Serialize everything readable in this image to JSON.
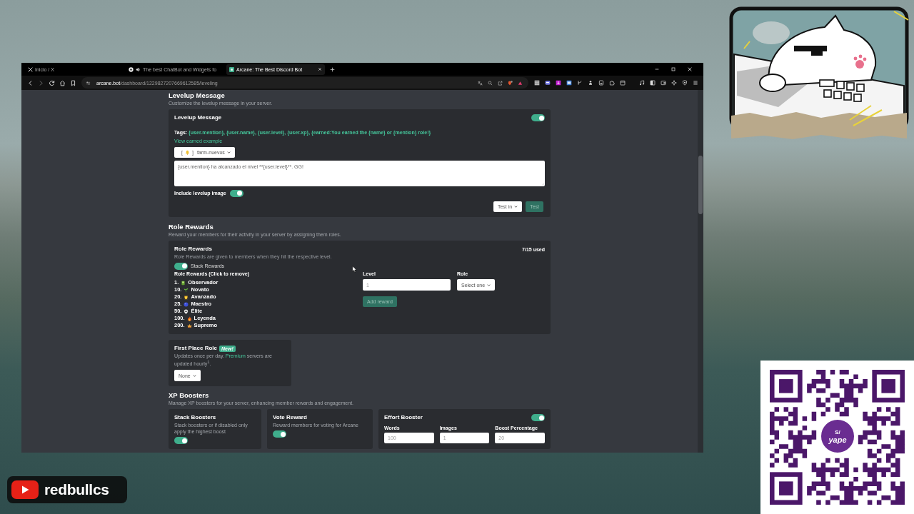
{
  "browser": {
    "tabs": [
      {
        "title": "Inicio / X",
        "kind": "x",
        "audio": false,
        "selected": false
      },
      {
        "title": "The best ChatBot and Widgets fo",
        "kind": "chatbot",
        "audio": true,
        "selected": false
      },
      {
        "title": "Arcane: The Best Discord Bot",
        "kind": "arcane",
        "audio": false,
        "selected": true
      }
    ],
    "url": {
      "domain": "arcane.bot",
      "path": "/dashboard/1229827207669612585/leveling"
    }
  },
  "levelup_message": {
    "heading": "Levelup Message",
    "subtitle": "Customize the levelup message in your server.",
    "card_title": "Levelup Message",
    "enabled": true,
    "tags_label": "Tags:",
    "tags": "{user.mention}, {user.name}, {user.level}, {user.xp}, {earned:You earned the {name} or {mention} role!}",
    "example_link": "View earned example",
    "channel": {
      "bracket_open": "[",
      "bracket_close": "]",
      "name": "farm-nuevos"
    },
    "message": "{user.mention} ha alcanzado el nivel **{user.level}**. GG!",
    "image_label": "Include levelup image",
    "include_image": true,
    "test_select": "Test in",
    "test_button": {
      "label": "Test",
      "disabled": true
    }
  },
  "role_rewards": {
    "heading": "Role Rewards",
    "subtitle": "Reward your members for their activity in your server by assigning them roles.",
    "card_title": "Role Rewards",
    "usage": "7/15 used",
    "description": "Role Rewards are given to members when they hit the respective level.",
    "stack_rewards": true,
    "stack_label": "Stack Rewards",
    "list_title": "Role Rewards (Click to remove)",
    "rewards": [
      {
        "level": "1.",
        "kind": "book",
        "name": "Observador"
      },
      {
        "level": "10.",
        "kind": "seedling",
        "name": "Novato"
      },
      {
        "level": "20.",
        "kind": "sun",
        "name": "Avanzado"
      },
      {
        "level": "25.",
        "kind": "orb",
        "name": "Maestro"
      },
      {
        "level": "50.",
        "kind": "skull",
        "name": "Élite"
      },
      {
        "level": "100.",
        "kind": "flame",
        "name": "Leyenda"
      },
      {
        "level": "200.",
        "kind": "crown",
        "name": "Supremo"
      }
    ],
    "level_field": {
      "label": "Level",
      "placeholder": "1"
    },
    "role_field": {
      "label": "Role",
      "value": "Select one"
    },
    "add_button": {
      "label": "Add reward",
      "disabled": true
    }
  },
  "first_place_role": {
    "title": "First Place Role",
    "badge": "New!",
    "description_before": "Updates once per day. ",
    "link": "Premium",
    "description_after": " servers are updated hourly$^{1}$.",
    "select": "None"
  },
  "xp_boosters": {
    "heading": "XP Boosters",
    "subtitle": "Manage XP boosters for your server, enhancing member rewards and engagement.",
    "cards": [
      {
        "kind": "toggle",
        "title": "Stack Boosters",
        "description": "Stack boosters or if disabled only apply the highest boost",
        "on": true
      },
      {
        "kind": "toggle",
        "title": "Vote Reward",
        "description": "Reward members for voting for Arcane",
        "on": true
      },
      {
        "kind": "fields",
        "title": "Effort Booster",
        "on": true,
        "fields": [
          {
            "label": "Words",
            "placeholder": "100"
          },
          {
            "label": "Images",
            "placeholder": "1"
          },
          {
            "label": "Boost Percentage",
            "placeholder": "20"
          }
        ]
      }
    ]
  },
  "stream_overlay": {
    "channel_name": "redbullcs",
    "qr_logo": {
      "symbol": "S/",
      "name": "yape"
    }
  }
}
